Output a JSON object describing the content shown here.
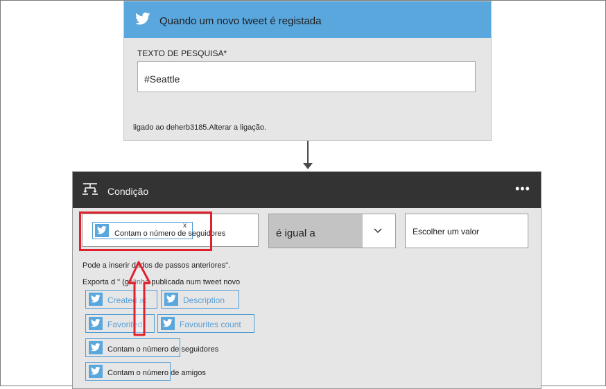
{
  "trigger": {
    "title": "Quando um novo tweet é registada",
    "icon": "twitter-bird-icon",
    "search_label": "TEXTO DE PESQUISA*",
    "search_value": "#Seattle",
    "connection_text": "ligado ao deherb3185.",
    "change_link": "Alterar a ligação."
  },
  "condition": {
    "title": "Condição",
    "more": "•••",
    "left_token": "Contam o número de seguidores",
    "left_token_remove": "x",
    "operator": "é igual a",
    "value_placeholder": "Escolher um valor",
    "hint": "Pode a inserir dados de passos anteriores\".",
    "export_text": "Exporta d       \" (galinha publicada num tweet novo",
    "chips": [
      {
        "label": "Created at"
      },
      {
        "label": "Description"
      },
      {
        "label": "Favorited"
      },
      {
        "label": "Favourites count"
      },
      {
        "label": "Contam o número de seguidores"
      },
      {
        "label": "Contam o número de amigos"
      }
    ]
  },
  "colors": {
    "trigger_header": "#5aa7de",
    "condition_header": "#333333",
    "token_border": "#4d9bd6",
    "annotation": "#e0222e"
  }
}
